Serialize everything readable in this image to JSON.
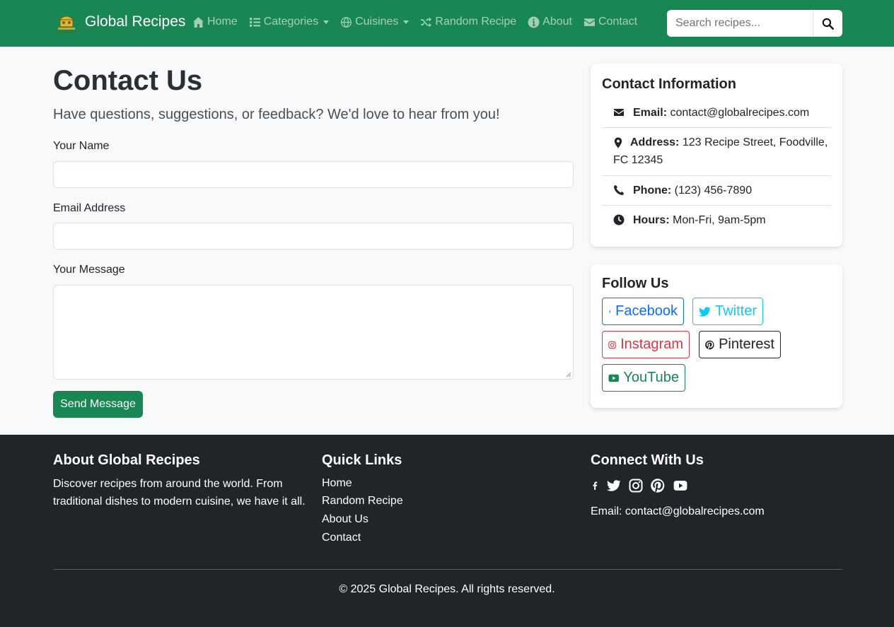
{
  "navbar": {
    "brand": "Global Recipes",
    "logo_icon": "recipe-hub-logo",
    "links": [
      {
        "label": "Home",
        "icon": "home-icon"
      },
      {
        "label": "Categories",
        "icon": "list-icon",
        "dropdown": true
      },
      {
        "label": "Cuisines",
        "icon": "globe-icon",
        "dropdown": true
      },
      {
        "label": "Random Recipe",
        "icon": "shuffle-icon"
      },
      {
        "label": "About",
        "icon": "info-icon"
      },
      {
        "label": "Contact",
        "icon": "envelope-icon"
      }
    ],
    "search_placeholder": "Search recipes..."
  },
  "main": {
    "title": "Contact Us",
    "lead": "Have questions, suggestions, or feedback? We'd love to hear from you!",
    "form": {
      "name_label": "Your Name",
      "email_label": "Email Address",
      "message_label": "Your Message",
      "submit_label": "Send Message"
    }
  },
  "contact_card": {
    "title": "Contact Information",
    "items": [
      {
        "label": "Email:",
        "value": "contact@globalrecipes.com",
        "icon": "envelope-icon"
      },
      {
        "label": "Address:",
        "value": "123 Recipe Street, Foodville,",
        "value2": "FC 12345",
        "icon": "map-marker-icon"
      },
      {
        "label": "Phone:",
        "value": "(123) 456-7890",
        "icon": "phone-icon"
      },
      {
        "label": "Hours:",
        "value": "Mon-Fri, 9am-5pm",
        "icon": "clock-icon"
      }
    ]
  },
  "follow_card": {
    "title": "Follow Us",
    "buttons": [
      {
        "label": "Facebook",
        "icon": "facebook-icon",
        "color": "#0d6efd"
      },
      {
        "label": "Twitter",
        "icon": "twitter-icon",
        "color": "#0dcaf0"
      },
      {
        "label": "Instagram",
        "icon": "instagram-icon",
        "color": "#dc3545"
      },
      {
        "label": "Pinterest",
        "icon": "pinterest-icon",
        "color": "#212529"
      },
      {
        "label": "YouTube",
        "icon": "youtube-icon",
        "color": "#198754"
      }
    ]
  },
  "footer": {
    "about_title": "About Global Recipes",
    "about_text_1": "Discover recipes from around the world. From",
    "about_text_2": "traditional dishes to modern cuisine, we have it all.",
    "links_title": "Quick Links",
    "links": [
      "Home",
      "Random Recipe",
      "About Us",
      "Contact"
    ],
    "connect_title": "Connect With Us",
    "email": "Email: contact@globalrecipes.com",
    "copyright": "© 2025 Global Recipes. All rights reserved."
  },
  "colors": {
    "brand_green": "#198754",
    "footer_bg": "#212529",
    "page_bg": "#f8f9fa"
  }
}
